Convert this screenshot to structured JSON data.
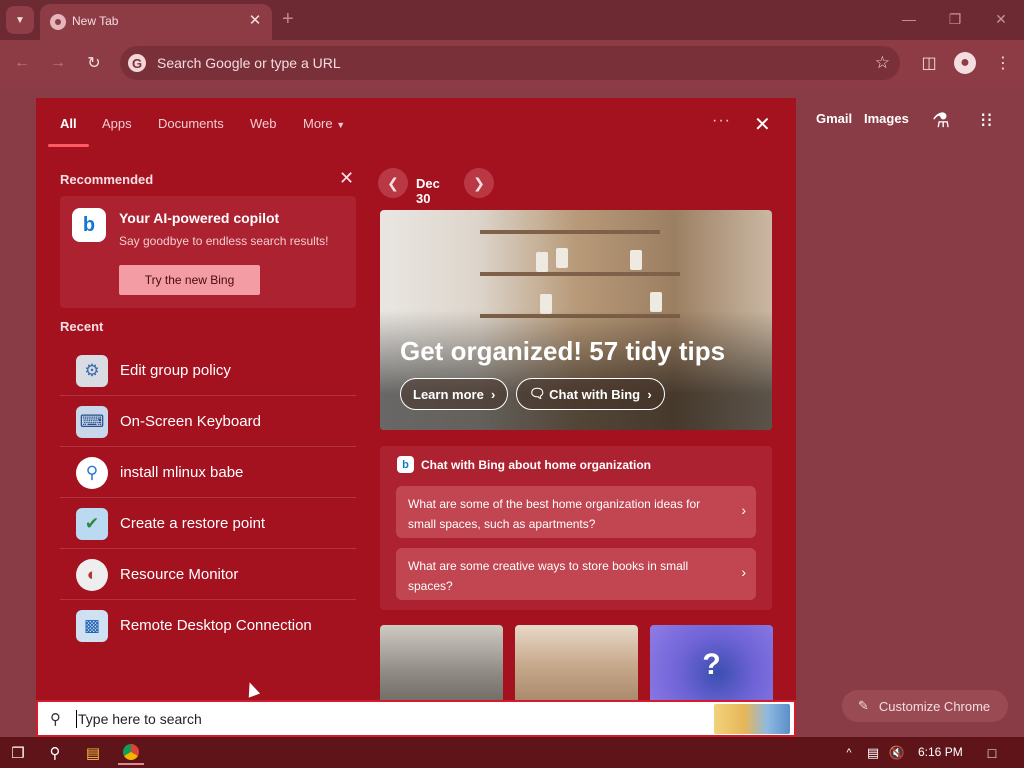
{
  "browser": {
    "tab_title": "New Tab",
    "new_tab": "+",
    "omnibox_placeholder": "Search Google or type a URL",
    "google_letter": "G"
  },
  "ntp": {
    "gmail": "Gmail",
    "images": "Images",
    "customize": "Customize Chrome"
  },
  "search_panel": {
    "tabs": [
      "All",
      "Apps",
      "Documents",
      "Web",
      "More"
    ],
    "active_tab": "All",
    "recommended": {
      "heading": "Recommended",
      "card_title": "Your AI-powered copilot",
      "card_subtitle": "Say goodbye to endless search results!",
      "card_button": "Try the new Bing"
    },
    "recent": {
      "heading": "Recent",
      "items": [
        {
          "label": "Edit group policy",
          "icon": "group-policy-icon"
        },
        {
          "label": "On-Screen Keyboard",
          "icon": "keyboard-icon"
        },
        {
          "label": "install mlinux babe",
          "icon": "search-icon"
        },
        {
          "label": "Create a restore point",
          "icon": "restore-point-icon"
        },
        {
          "label": "Resource Monitor",
          "icon": "resource-monitor-icon"
        },
        {
          "label": "Remote Desktop Connection",
          "icon": "remote-desktop-icon"
        }
      ]
    },
    "date": "Dec 30",
    "hero": {
      "headline": "Get organized! 57 tidy tips",
      "learn_more": "Learn more",
      "chat_with_bing": "Chat with Bing"
    },
    "chat": {
      "heading": "Chat with Bing about home organization",
      "questions": [
        "What are some of the best home organization ideas for small spaces, such as apartments?",
        "What are some creative ways to store books in small spaces?"
      ]
    }
  },
  "searchbar": {
    "placeholder": "Type here to search"
  },
  "taskbar": {
    "time": "6:16 PM"
  },
  "colors": {
    "panel_bg": "#a4111f",
    "page_bg": "#8a3c46",
    "accent": "#ff5a63"
  }
}
